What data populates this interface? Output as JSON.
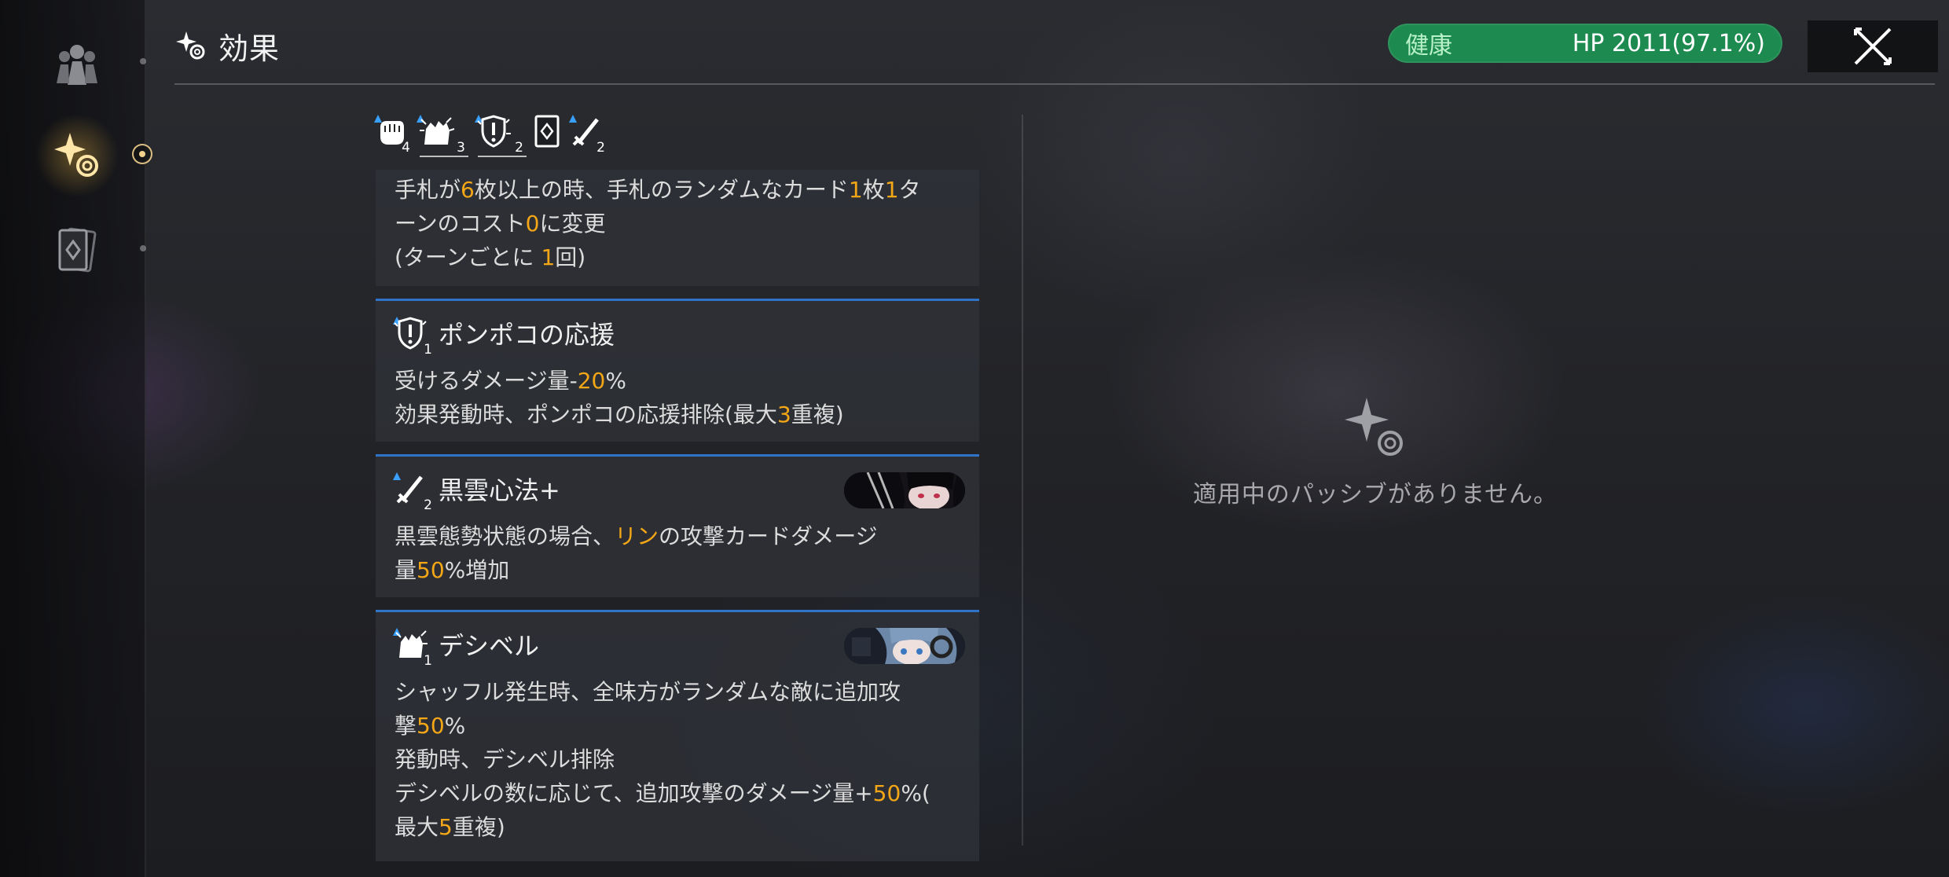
{
  "header": {
    "title": "効果",
    "hp_status": "健康",
    "hp_text": "HP 2011(97.1%)",
    "hp_fraction": 0.971,
    "hp_color": "#1d8a4f"
  },
  "sidebar": {
    "items": [
      {
        "icon": "team-icon",
        "active": false
      },
      {
        "icon": "effects-sparkle-icon",
        "active": true
      },
      {
        "icon": "deck-card-icon",
        "active": false
      }
    ]
  },
  "buff_strip": [
    {
      "icon": "fist-buff-icon",
      "stacks": "4"
    },
    {
      "icon": "hand-burst-buff-icon",
      "stacks": "3"
    },
    {
      "icon": "shield-buff-icon",
      "stacks": "2"
    },
    {
      "icon": "card-buff-icon",
      "stacks": ""
    },
    {
      "icon": "sword-buff-icon",
      "stacks": "2"
    }
  ],
  "cards": [
    {
      "body_parts": [
        [
          "手札が",
          "6",
          "枚以上の時、手札のランダムなカード",
          "1",
          "枚",
          "1",
          "タ"
        ],
        [
          "ーンのコスト",
          "0",
          "に変更"
        ],
        [
          "(ターンごとに ",
          "1",
          "回)"
        ]
      ]
    },
    {
      "title": "ポンポコの応援",
      "icon": "shield-buff-icon",
      "stacks": "1",
      "body_parts": [
        [
          "受けるダメージ量-",
          "20",
          "%"
        ],
        [
          "効果発動時、ポンポコの応援排除(最大",
          "3",
          "重複)"
        ]
      ]
    },
    {
      "title": "黒雲心法+",
      "icon": "sword-buff-icon",
      "stacks": "2",
      "portrait": "rin-portrait",
      "body_parts": [
        [
          "黒雲態勢状態の場合、",
          "リン",
          "の攻撃カードダメージ"
        ],
        [
          "量",
          "50",
          "%増加"
        ]
      ]
    },
    {
      "title": "デシベル",
      "icon": "hand-burst-buff-icon",
      "stacks": "1",
      "portrait": "decibel-portrait",
      "body_parts": [
        [
          "シャッフル発生時、全味方がランダムな敵に追加攻"
        ],
        [
          "撃",
          "50",
          "%"
        ],
        [
          "発動時、デシベル排除"
        ],
        [
          "デシベルの数に応じて、追加攻撃のダメージ量+",
          "50",
          "%("
        ],
        [
          "最大",
          "5",
          "重複)"
        ]
      ]
    }
  ],
  "passive": {
    "empty_text": "適用中のパッシブがありません。"
  },
  "colors": {
    "highlight": "#f3a716",
    "card_border": "#2f74c9"
  }
}
